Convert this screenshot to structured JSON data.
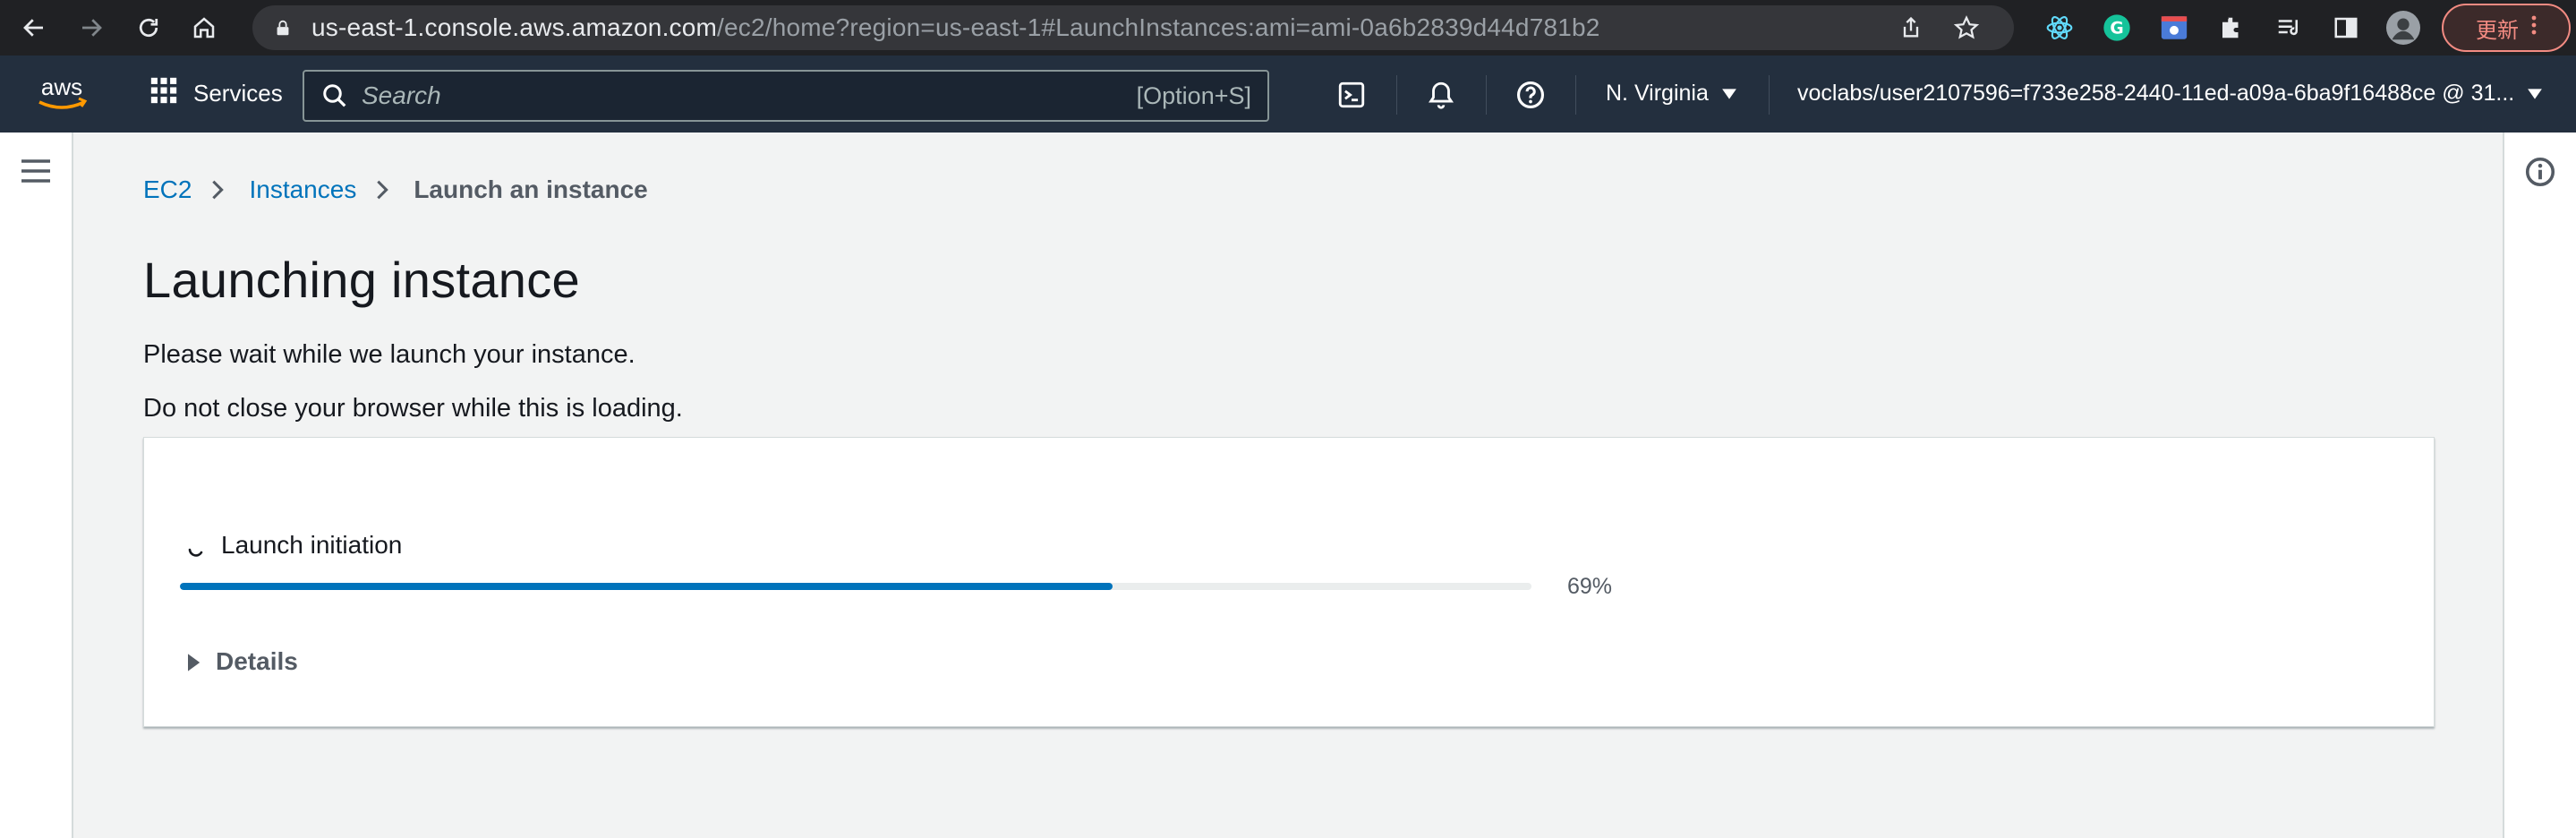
{
  "browser": {
    "url_host": "us-east-1.console.aws.amazon.com",
    "url_path": "/ec2/home?region=us-east-1#LaunchInstances:ami=ami-0a6b2839d44d781b2",
    "update_label": "更新"
  },
  "aws_header": {
    "logo_text": "aws",
    "services_label": "Services",
    "search_placeholder": "Search",
    "search_shortcut": "[Option+S]",
    "region_label": "N. Virginia",
    "account_label": "voclabs/user2107596=f733e258-2440-11ed-a09a-6ba9f16488ce @ 31..."
  },
  "breadcrumb": {
    "items": [
      {
        "label": "EC2"
      },
      {
        "label": "Instances"
      },
      {
        "label": "Launch an instance"
      }
    ]
  },
  "main": {
    "title": "Launching instance",
    "message_1": "Please wait while we launch your instance.",
    "message_2": "Do not close your browser while this is loading."
  },
  "progress": {
    "step_label": "Launch initiation",
    "percent": 69,
    "percent_text": "69%",
    "details_label": "Details"
  },
  "colors": {
    "header_bg": "#232f3e",
    "link": "#0073bb",
    "progress_fill": "#0073bb",
    "aws_orange": "#ff9900"
  },
  "icons": {
    "browser_nav": [
      "back-icon",
      "forward-icon",
      "reload-icon",
      "home-icon"
    ],
    "omnibox": [
      "lock-icon",
      "share-icon",
      "star-icon"
    ],
    "extensions": [
      "react-devtools-icon",
      "grammarly-icon",
      "extension-card-icon",
      "puzzle-icon",
      "reading-list-icon",
      "side-panel-icon",
      "profile-avatar"
    ],
    "header": [
      "grid-icon",
      "search-icon",
      "cloudshell-icon",
      "bell-icon",
      "help-icon",
      "caret-down-icon"
    ],
    "page": [
      "hamburger-icon",
      "info-icon",
      "spinner-icon",
      "caret-right-icon"
    ]
  }
}
